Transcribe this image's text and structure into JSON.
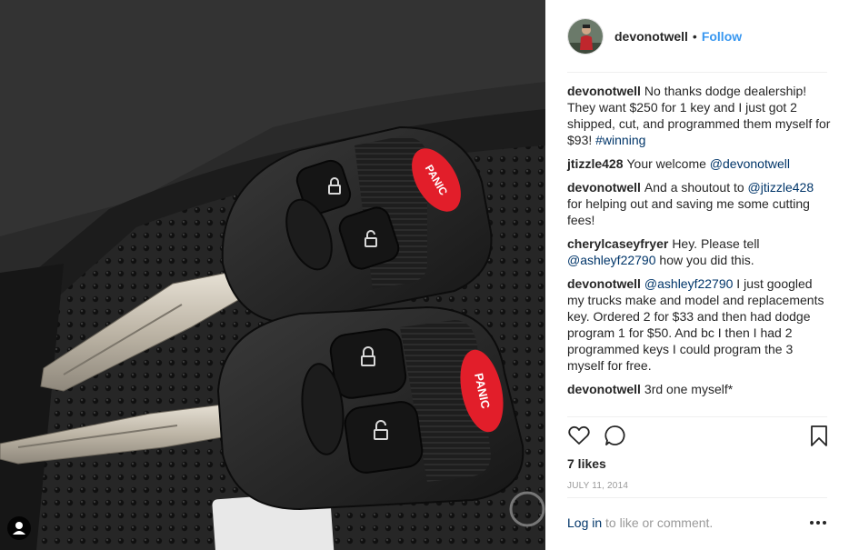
{
  "photo": {
    "alt": "Two car key fobs on a rubber mat",
    "button_labels": [
      "PANIC",
      "PANIC"
    ],
    "tag_icon": "user-tag-icon"
  },
  "header": {
    "username": "devonotwell",
    "separator": "•",
    "follow_label": "Follow"
  },
  "comments": [
    {
      "user": "devonotwell",
      "parts": [
        {
          "type": "text",
          "value": "No thanks dodge dealership! They want $250 for 1 key and I just got 2 shipped, cut, and programmed them myself for $93! "
        },
        {
          "type": "link",
          "value": "#winning"
        }
      ]
    },
    {
      "user": "jtizzle428",
      "parts": [
        {
          "type": "text",
          "value": "Your welcome "
        },
        {
          "type": "link",
          "value": "@devonotwell"
        }
      ]
    },
    {
      "user": "devonotwell",
      "parts": [
        {
          "type": "text",
          "value": "And a shoutout to "
        },
        {
          "type": "link",
          "value": "@jtizzle428"
        },
        {
          "type": "text",
          "value": " for helping out and saving me some cutting fees!"
        }
      ]
    },
    {
      "user": "cherylcaseyfryer",
      "parts": [
        {
          "type": "text",
          "value": "Hey. Please tell "
        },
        {
          "type": "link",
          "value": "@ashleyf22790"
        },
        {
          "type": "text",
          "value": " how you did this."
        }
      ]
    },
    {
      "user": "devonotwell",
      "parts": [
        {
          "type": "link",
          "value": "@ashleyf22790"
        },
        {
          "type": "text",
          "value": " I just googled my trucks make and model and replacements key. Ordered 2 for $33 and then had dodge program 1 for $50. And bc I then I had 2 programmed keys I could program the 3 myself for free."
        }
      ]
    },
    {
      "user": "devonotwell",
      "parts": [
        {
          "type": "text",
          "value": "3rd one myself*"
        }
      ]
    }
  ],
  "actions": {
    "like_icon": "heart-icon",
    "comment_icon": "comment-bubble-icon",
    "save_icon": "bookmark-icon"
  },
  "likes_text": "7 likes",
  "date_text": "JULY 11, 2014",
  "footer": {
    "login_label": "Log in",
    "rest_text": " to like or comment.",
    "more_icon": "more-options-icon"
  },
  "colors": {
    "link_blue": "#003569",
    "follow_blue": "#3897f0",
    "panic_red": "#e21e2a",
    "muted_gray": "#999999",
    "divider": "#efefef"
  }
}
